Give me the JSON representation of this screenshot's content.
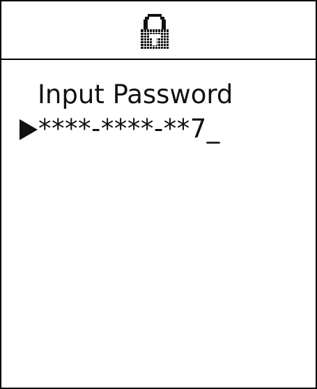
{
  "header": {
    "icon": "lock-icon"
  },
  "main": {
    "prompt": "Input Password",
    "password_value": "****-****-**7_",
    "cursor_icon": "selection-arrow-icon"
  },
  "colors": {
    "foreground": "#111111",
    "background": "#ffffff",
    "border": "#000000"
  }
}
